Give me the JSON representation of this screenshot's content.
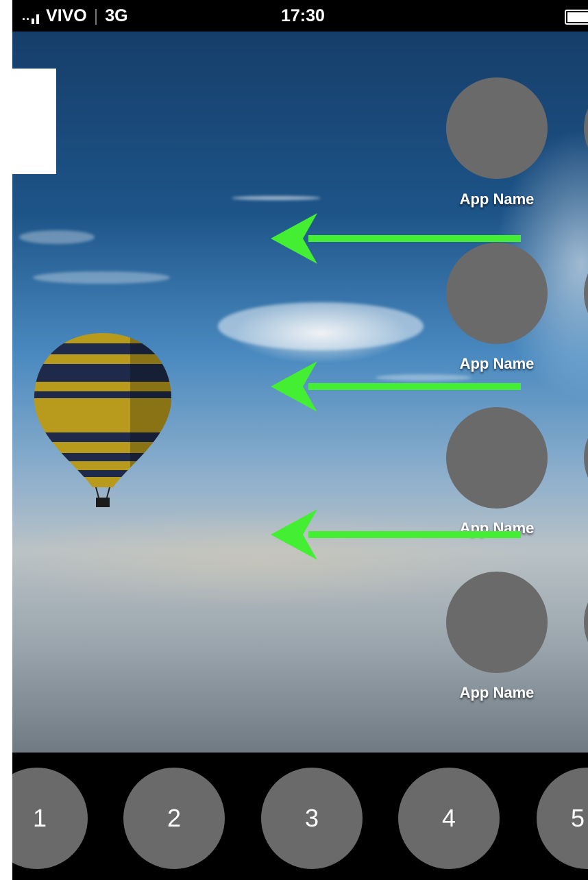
{
  "status_bar": {
    "carrier": "VIVO",
    "network": "3G",
    "time": "17:30",
    "signal_icon": "signal-bars-icon",
    "battery_icon": "battery-icon"
  },
  "apps": [
    {
      "label": "App Name"
    },
    {
      "label": "App Name"
    },
    {
      "label": "App Name"
    },
    {
      "label": "App Name"
    }
  ],
  "dock": {
    "items": [
      {
        "label": "1"
      },
      {
        "label": "2"
      },
      {
        "label": "3"
      },
      {
        "label": "4"
      },
      {
        "label": "5"
      }
    ]
  },
  "colors": {
    "arrow": "#44ee33",
    "icon_placeholder": "#6a6a6a",
    "status_bar_bg": "#000000",
    "dock_bg": "#000000"
  }
}
